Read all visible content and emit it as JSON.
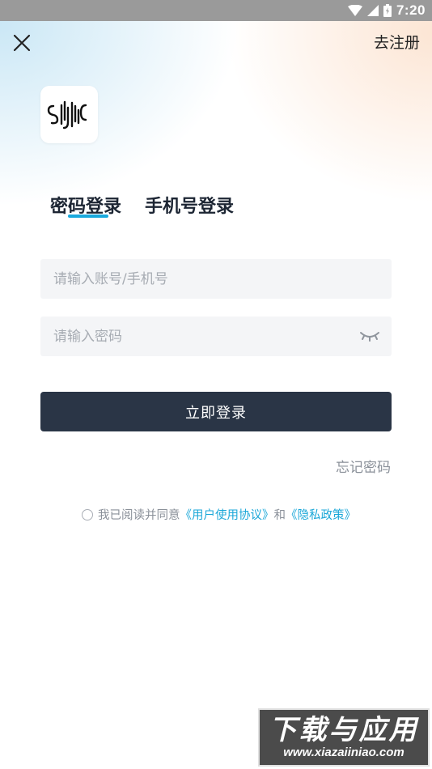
{
  "status_bar": {
    "time": "7:20",
    "icons": [
      "wifi-icon",
      "cellular-signal-icon",
      "battery-icon"
    ]
  },
  "header": {
    "close_icon": "close-icon",
    "register_label": "去注册"
  },
  "logo": {
    "text": "SYNC"
  },
  "tabs": [
    {
      "label": "密码登录",
      "active": true
    },
    {
      "label": "手机号登录",
      "active": false
    }
  ],
  "form": {
    "account_placeholder": "请输入账号/手机号",
    "account_value": "",
    "password_placeholder": "请输入密码",
    "password_value": "",
    "eye_icon": "eye-closed-icon",
    "login_label": "立即登录",
    "forgot_label": "忘记密码"
  },
  "agreement": {
    "prefix": "我已阅读并同意",
    "user_agreement": "《用户使用协议》",
    "and": "和",
    "privacy_policy": "《隐私政策》",
    "checked": false
  },
  "watermark": {
    "title": "下载与应用",
    "url": "www.xiazaiiniao.com"
  },
  "colors": {
    "accent": "#19a9dd",
    "button": "#2a3546",
    "field_bg": "#f4f5f7",
    "link": "#1aa7d8"
  }
}
